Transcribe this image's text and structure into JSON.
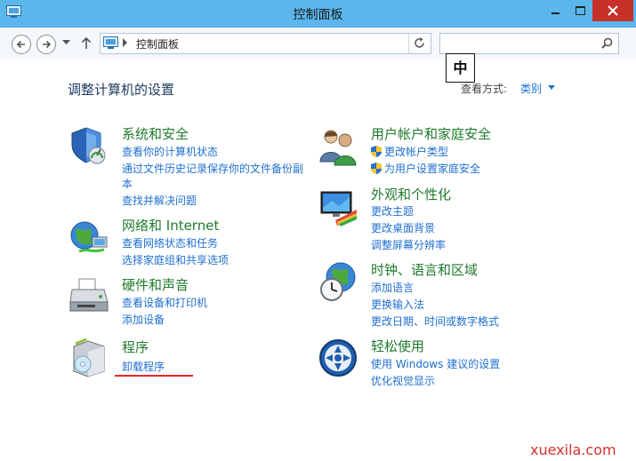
{
  "window": {
    "title": "控制面板"
  },
  "address": {
    "path": "控制面板",
    "search_placeholder": ""
  },
  "ime": {
    "label": "中"
  },
  "page": {
    "heading": "调整计算机的设置",
    "view_by_label": "查看方式:",
    "view_by_value": "类别"
  },
  "left_categories": [
    {
      "title": "系统和安全",
      "icon": "security-shield-icon",
      "links": [
        "查看你的计算机状态",
        "通过文件历史记录保存你的文件备份副",
        "本",
        "查找并解决问题"
      ]
    },
    {
      "title": "网络和 Internet",
      "icon": "network-globe-icon",
      "links": [
        "查看网络状态和任务",
        "选择家庭组和共享选项"
      ]
    },
    {
      "title": "硬件和声音",
      "icon": "printer-icon",
      "links": [
        "查看设备和打印机",
        "添加设备"
      ]
    },
    {
      "title": "程序",
      "icon": "programs-box-icon",
      "links": [
        "卸载程序"
      ]
    }
  ],
  "right_categories": [
    {
      "title": "用户帐户和家庭安全",
      "icon": "users-icon",
      "links": [
        "更改帐户类型",
        "为用户设置家庭安全"
      ]
    },
    {
      "title": "外观和个性化",
      "icon": "monitor-palette-icon",
      "links": [
        "更改主题",
        "更改桌面背景",
        "调整屏幕分辨率"
      ]
    },
    {
      "title": "时钟、语言和区域",
      "icon": "clock-globe-icon",
      "links": [
        "添加语言",
        "更换输入法",
        "更改日期、时间或数字格式"
      ]
    },
    {
      "title": "轻松使用",
      "icon": "ease-of-access-icon",
      "links": [
        "使用 Windows 建议的设置",
        "优化视觉显示"
      ]
    }
  ],
  "watermark": "xuexila.com"
}
